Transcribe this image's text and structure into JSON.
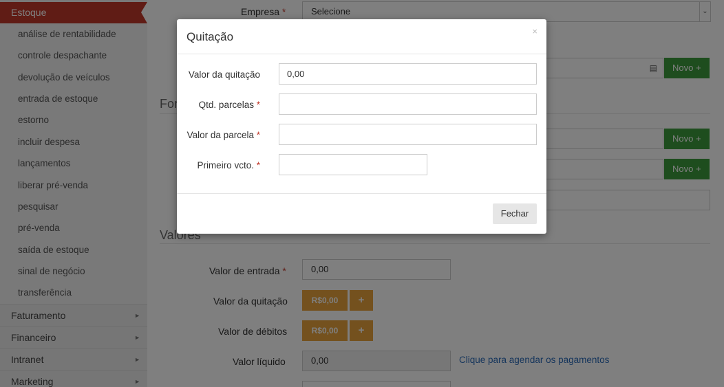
{
  "sidebar": {
    "active": "Estoque",
    "items": [
      "análise de rentabilidade",
      "controle despachante",
      "devolução de veículos",
      "entrada de estoque",
      "estorno",
      "incluir despesa",
      "lançamentos",
      "liberar pré-venda",
      "pesquisar",
      "pré-venda",
      "saída de estoque",
      "sinal de negócio",
      "transferência"
    ],
    "categories": [
      "Faturamento",
      "Financeiro",
      "Intranet",
      "Marketing"
    ]
  },
  "form": {
    "empresa_label": "Empresa",
    "empresa_value": "Selecione",
    "novo_label": "Novo",
    "section_partial": "For",
    "valores_title": "Valores",
    "valor_entrada_label": "Valor de entrada",
    "valor_entrada_value": "0,00",
    "valor_quitacao_label": "Valor da quitação",
    "valor_quitacao_badge": "R$0,00",
    "valor_debitos_label": "Valor de débitos",
    "valor_debitos_badge": "R$0,00",
    "valor_liquido_label": "Valor líquido",
    "valor_liquido_value": "0,00",
    "agendar_link": "Clique para agendar os pagamentos",
    "plus": "+",
    "required_mark": "*"
  },
  "modal": {
    "title": "Quitação",
    "close": "×",
    "fields": {
      "valor_quitacao_label": "Valor da quitação",
      "valor_quitacao_value": "0,00",
      "qtd_parcelas_label": "Qtd. parcelas",
      "valor_parcela_label": "Valor da parcela",
      "primeiro_vcto_label": "Primeiro vcto."
    },
    "fechar": "Fechar"
  }
}
